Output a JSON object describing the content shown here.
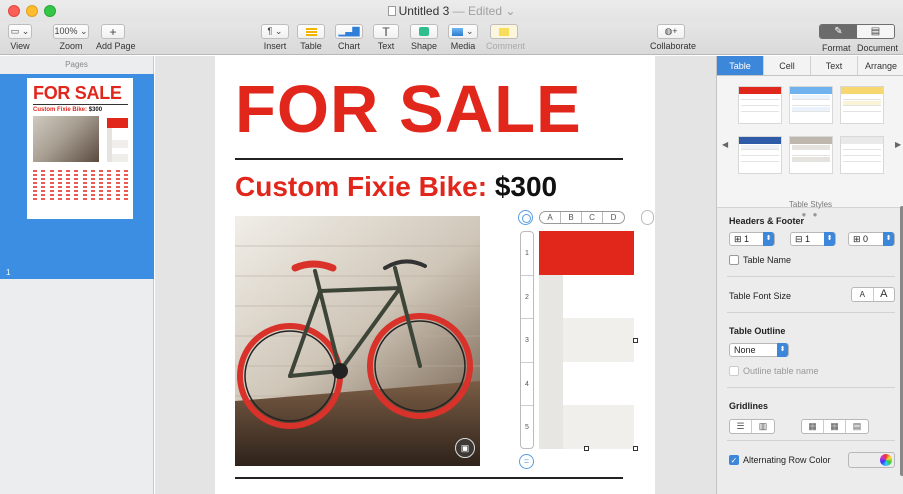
{
  "window": {
    "title": "Untitled 3",
    "edited": "— Edited ⌄"
  },
  "toolbar": {
    "view": "View",
    "zoom_value": "100% ⌄",
    "zoom": "Zoom",
    "add_page": "Add Page",
    "insert": "Insert",
    "table": "Table",
    "chart": "Chart",
    "text": "Text",
    "shape": "Shape",
    "media": "Media",
    "comment": "Comment",
    "collaborate": "Collaborate",
    "format": "Format",
    "document": "Document"
  },
  "sidebar": {
    "header": "Pages",
    "page_number": "1",
    "thumb_title": "FOR SALE",
    "thumb_sub": "Custom Fixie Bike:",
    "thumb_price": "$300"
  },
  "page": {
    "headline": "FOR SALE",
    "subtitle": "Custom Fixie Bike:",
    "price": "$300",
    "table_columns": [
      "A",
      "B",
      "C",
      "D"
    ],
    "table_rows": [
      "1",
      "2",
      "3",
      "4",
      "5"
    ]
  },
  "inspector": {
    "tabs": [
      "Table",
      "Cell",
      "Text",
      "Arrange"
    ],
    "table_styles_label": "Table Styles",
    "headers_footer": "Headers & Footer",
    "header_rows": "1",
    "header_cols": "1",
    "footer_rows": "0",
    "table_name": "Table Name",
    "table_font_size": "Table Font Size",
    "font_small": "A",
    "font_large": "A",
    "table_outline": "Table Outline",
    "outline_value": "None",
    "outline_table_name": "Outline table name",
    "gridlines": "Gridlines",
    "alternating_row_color": "Alternating Row Color"
  },
  "colors": {
    "accent": "#e1261c",
    "selection": "#3c8ee2"
  }
}
